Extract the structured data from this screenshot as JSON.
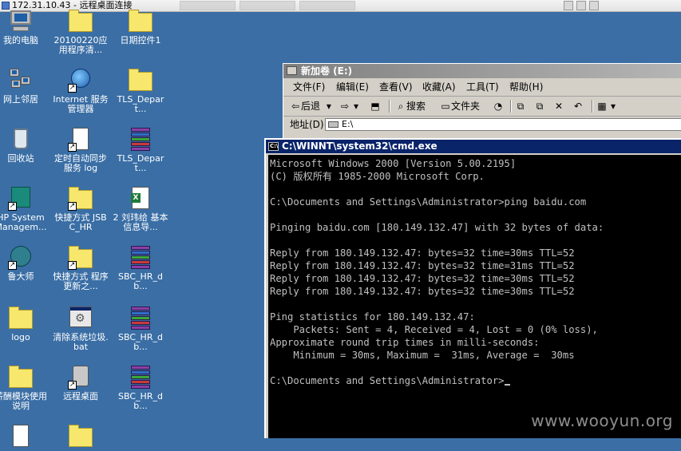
{
  "remote_session": {
    "title": "172.31.10.43 - 远程桌面连接"
  },
  "desktop": {
    "icons": [
      {
        "label": "我的电脑"
      },
      {
        "label": "20100220应用程序清..."
      },
      {
        "label": "日期控件1"
      },
      {
        "label": "网上邻居"
      },
      {
        "label": "Internet 服务管理器"
      },
      {
        "label": "TLS_Depart..."
      },
      {
        "label": "回收站"
      },
      {
        "label": "定时自动同步服务 log"
      },
      {
        "label": "TLS_Depart..."
      },
      {
        "label": "HP System Managem..."
      },
      {
        "label": "快捷方式 JSBC_HR"
      },
      {
        "label": "2 刘玮给 基本信息导..."
      },
      {
        "label": "鲁大师"
      },
      {
        "label": "快捷方式 程序更新之..."
      },
      {
        "label": "SBC_HR_db..."
      },
      {
        "label": "logo"
      },
      {
        "label": "清除系统垃圾.bat"
      },
      {
        "label": "SBC_HR_db..."
      },
      {
        "label": "薪酬模块使用说明"
      },
      {
        "label": "远程桌面"
      },
      {
        "label": "SBC_HR_db..."
      }
    ]
  },
  "explorer": {
    "title": "新加卷 (E:)",
    "menu": [
      "文件(F)",
      "编辑(E)",
      "查看(V)",
      "收藏(A)",
      "工具(T)",
      "帮助(H)"
    ],
    "toolbar": {
      "back": "后退",
      "search": "搜索",
      "folders": "文件夹"
    },
    "address": {
      "label": "地址(D)",
      "value": "E:\\"
    }
  },
  "cmd": {
    "title": "C:\\WINNT\\system32\\cmd.exe",
    "lines": [
      "Microsoft Windows 2000 [Version 5.00.2195]",
      "(C) 版权所有 1985-2000 Microsoft Corp.",
      "",
      "C:\\Documents and Settings\\Administrator>ping baidu.com",
      "",
      "Pinging baidu.com [180.149.132.47] with 32 bytes of data:",
      "",
      "Reply from 180.149.132.47: bytes=32 time=30ms TTL=52",
      "Reply from 180.149.132.47: bytes=32 time=31ms TTL=52",
      "Reply from 180.149.132.47: bytes=32 time=30ms TTL=52",
      "Reply from 180.149.132.47: bytes=32 time=30ms TTL=52",
      "",
      "Ping statistics for 180.149.132.47:",
      "    Packets: Sent = 4, Received = 4, Lost = 0 (0% loss),",
      "Approximate round trip times in milli-seconds:",
      "    Minimum = 30ms, Maximum =  31ms, Average =  30ms",
      ""
    ],
    "prompt": "C:\\Documents and Settings\\Administrator>"
  },
  "watermark": "www.wooyun.org"
}
